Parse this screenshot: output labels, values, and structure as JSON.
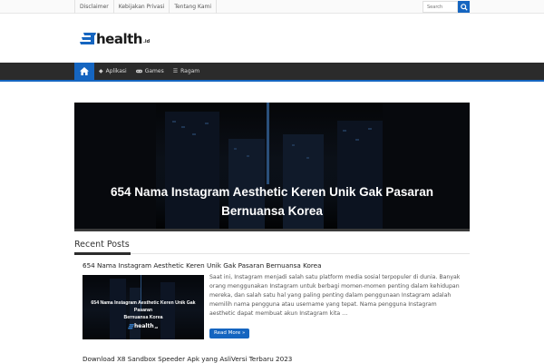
{
  "topbar": {
    "links": [
      "Disclaimer",
      "Kebijakan Privasi",
      "Tentang Kami"
    ],
    "search_placeholder": "Search"
  },
  "logo": {
    "word": "health",
    "suffix": ".id"
  },
  "navbar": {
    "items": [
      {
        "label": "Aplikasi",
        "icon": "android-icon"
      },
      {
        "label": "Games",
        "icon": "gamepad-icon"
      },
      {
        "label": "Ragam",
        "icon": "list-icon"
      }
    ]
  },
  "hero": {
    "line1": "654 Nama Instagram Aesthetic Keren Unik Gak Pasaran",
    "line2": "Bernuansa Korea"
  },
  "recent_posts": {
    "heading": "Recent Posts",
    "posts": [
      {
        "title": "654 Nama Instagram Aesthetic Keren Unik Gak Pasaran Bernuansa Korea",
        "thumb_line1": "654 Nama Instagram Aesthetic Keren Unik Gak Pasaran",
        "thumb_line2": "Bernuansa Korea",
        "thumb_logo": "health",
        "thumb_logo_suffix": ".id",
        "excerpt": "Saat ini, Instagram menjadi salah satu platform media sosial terpopuler di dunia. Banyak orang menggunakan Instagram untuk berbagi momen-momen penting dalam kehidupan mereka, dan salah satu hal yang paling penting dalam penggunaan Instagram adalah memilih nama pengguna atau username yang tepat. Nama pengguna Instagram aesthetic dapat membuat akun Instagram kita …",
        "read_more": "Read More »"
      },
      {
        "title": "Download X8 Sandbox Speeder Apk yang AsliVersi Terbaru 2023"
      }
    ]
  },
  "colors": {
    "accent": "#1565c0",
    "navbar": "#2b2b2b"
  }
}
